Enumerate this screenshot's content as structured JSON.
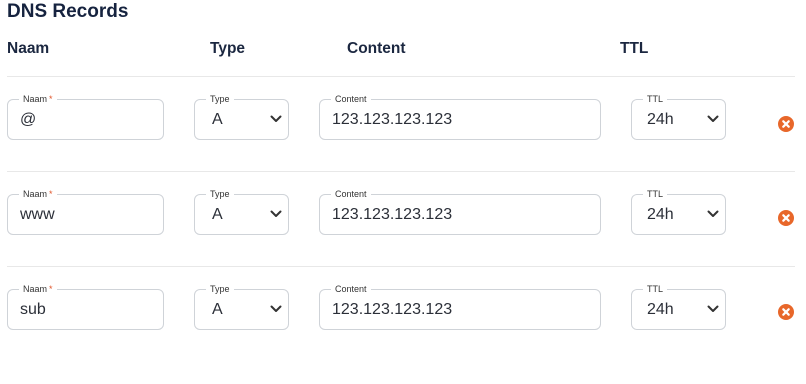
{
  "section_title": "DNS Records",
  "columns": {
    "name": "Naam",
    "type": "Type",
    "content": "Content",
    "ttl": "TTL"
  },
  "field_labels": {
    "name": "Naam",
    "required_mark": "*",
    "type": "Type",
    "content": "Content",
    "ttl": "TTL"
  },
  "records": [
    {
      "name": "@",
      "type": "A",
      "content": "123.123.123.123",
      "ttl": "24h"
    },
    {
      "name": "www",
      "type": "A",
      "content": "123.123.123.123",
      "ttl": "24h"
    },
    {
      "name": "sub",
      "type": "A",
      "content": "123.123.123.123",
      "ttl": "24h"
    }
  ],
  "colors": {
    "remove": "#e8672a",
    "border": "#cfd3d8",
    "heading": "#16233f",
    "required": "#e0542a"
  },
  "icons": {
    "remove": "remove-circle-icon",
    "select": "chevron-down-icon"
  }
}
